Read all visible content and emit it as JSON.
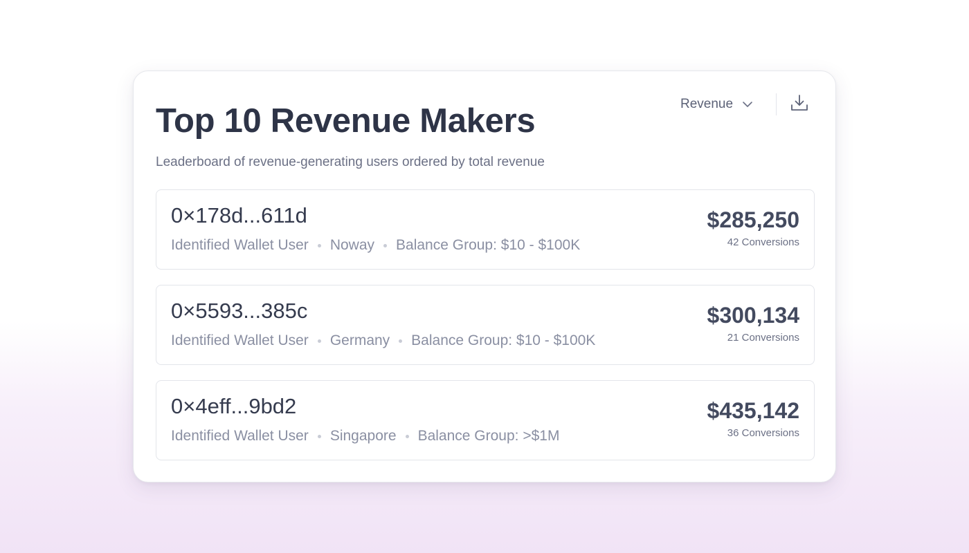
{
  "header": {
    "title": "Top 10 Revenue Makers",
    "subtitle": "Leaderboard of revenue-generating users ordered by total revenue"
  },
  "controls": {
    "metric_label": "Revenue",
    "metric_icon": "chevron-down-icon",
    "download_icon": "download-icon"
  },
  "rows": [
    {
      "wallet": "0×178d...611d",
      "user_type": "Identified Wallet User",
      "country": "Noway",
      "balance_group": "Balance Group: $10 - $100K",
      "revenue": "$285,250",
      "conversions": "42 Conversions"
    },
    {
      "wallet": "0×5593...385c",
      "user_type": "Identified Wallet User",
      "country": "Germany",
      "balance_group": "Balance Group: $10 - $100K",
      "revenue": "$300,134",
      "conversions": "21 Conversions"
    },
    {
      "wallet": "0×4eff...9bd2",
      "user_type": "Identified Wallet User",
      "country": "Singapore",
      "balance_group": "Balance Group: >$1M",
      "revenue": "$435,142",
      "conversions": "36 Conversions"
    }
  ],
  "colors": {
    "title": "#2e3447",
    "muted": "#8a8fa2",
    "border": "#e3e5ea",
    "background_tint": "#f1e3f6"
  }
}
